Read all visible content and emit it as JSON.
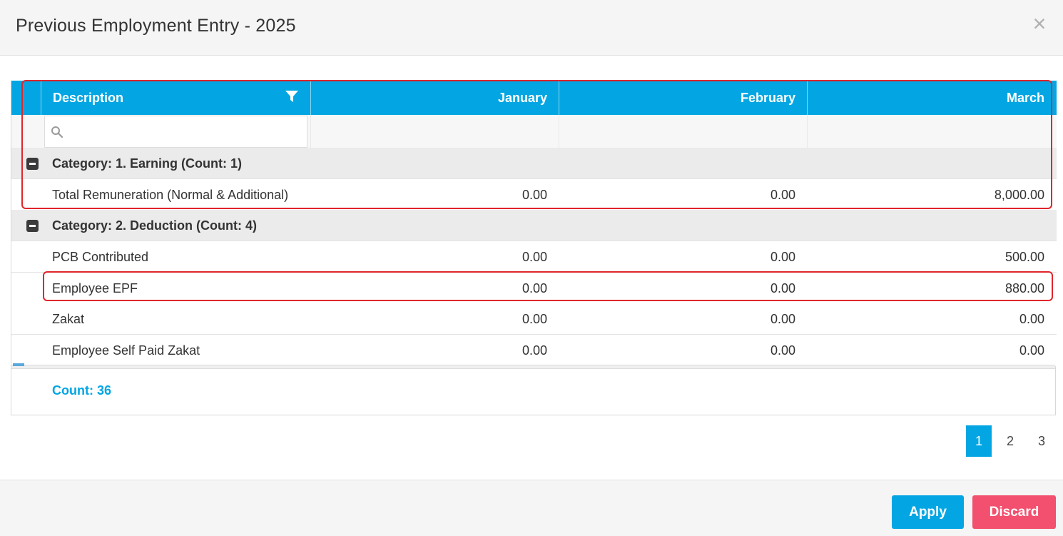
{
  "modal": {
    "title": "Previous Employment Entry - 2025",
    "close_icon": "close-icon"
  },
  "grid": {
    "columns": [
      "Description",
      "January",
      "February",
      "March"
    ],
    "filter_icon": "filter-icon",
    "search": {
      "placeholder": "",
      "value": "",
      "icon": "search-icon"
    },
    "groups": [
      {
        "label": "Category: 1. Earning (Count: 1)"
      },
      {
        "label": "Category: 2. Deduction (Count: 4)"
      }
    ],
    "rows": [
      {
        "description": "Total Remuneration (Normal & Additional)",
        "january": "0.00",
        "february": "0.00",
        "march": "8,000.00"
      },
      {
        "description": "PCB Contributed",
        "january": "0.00",
        "february": "0.00",
        "march": "500.00"
      },
      {
        "description": "Employee EPF",
        "january": "0.00",
        "february": "0.00",
        "march": "880.00"
      },
      {
        "description": "Zakat",
        "january": "0.00",
        "february": "0.00",
        "march": "0.00"
      },
      {
        "description": "Employee Self Paid Zakat",
        "january": "0.00",
        "february": "0.00",
        "march": "0.00"
      }
    ],
    "footer_count": "Count: 36"
  },
  "pagination": {
    "pages": [
      "1",
      "2",
      "3"
    ],
    "current": "1"
  },
  "actions": {
    "apply_label": "Apply",
    "discard_label": "Discard"
  },
  "colors": {
    "accent": "#03a6e3",
    "discard": "#f2506e",
    "highlight": "#e0262b"
  }
}
